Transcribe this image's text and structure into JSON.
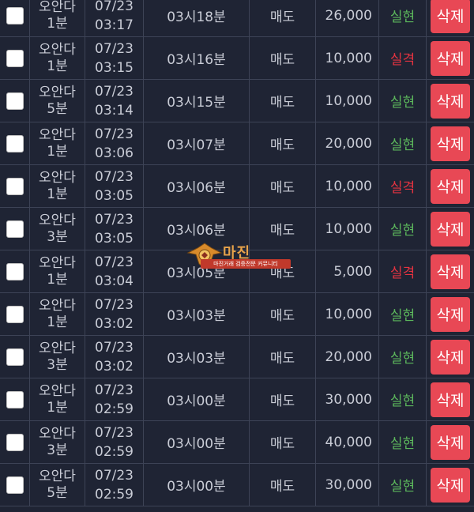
{
  "rows": [
    {
      "game": [
        "오안다",
        "1분"
      ],
      "date": "07/23",
      "time": "03:17",
      "round": "03시18분",
      "type": "매도",
      "amount": "26,000",
      "result": "실현",
      "status": "win",
      "action": "삭제"
    },
    {
      "game": [
        "오안다",
        "1분"
      ],
      "date": "07/23",
      "time": "03:15",
      "round": "03시16분",
      "type": "매도",
      "amount": "10,000",
      "result": "실격",
      "status": "lose",
      "action": "삭제"
    },
    {
      "game": [
        "오안다",
        "5분"
      ],
      "date": "07/23",
      "time": "03:14",
      "round": "03시15분",
      "type": "매도",
      "amount": "10,000",
      "result": "실현",
      "status": "win",
      "action": "삭제"
    },
    {
      "game": [
        "오안다",
        "1분"
      ],
      "date": "07/23",
      "time": "03:06",
      "round": "03시07분",
      "type": "매도",
      "amount": "20,000",
      "result": "실현",
      "status": "win",
      "action": "삭제"
    },
    {
      "game": [
        "오안다",
        "1분"
      ],
      "date": "07/23",
      "time": "03:05",
      "round": "03시06분",
      "type": "매도",
      "amount": "10,000",
      "result": "실격",
      "status": "lose",
      "action": "삭제"
    },
    {
      "game": [
        "오안다",
        "3분"
      ],
      "date": "07/23",
      "time": "03:05",
      "round": "03시06분",
      "type": "매도",
      "amount": "10,000",
      "result": "실현",
      "status": "win",
      "action": "삭제"
    },
    {
      "game": [
        "오안다",
        "1분"
      ],
      "date": "07/23",
      "time": "03:04",
      "round": "03시05분",
      "type": "매도",
      "amount": "5,000",
      "result": "실격",
      "status": "lose",
      "action": "삭제"
    },
    {
      "game": [
        "오안다",
        "1분"
      ],
      "date": "07/23",
      "time": "03:02",
      "round": "03시03분",
      "type": "매도",
      "amount": "10,000",
      "result": "실현",
      "status": "win",
      "action": "삭제"
    },
    {
      "game": [
        "오안다",
        "3분"
      ],
      "date": "07/23",
      "time": "03:02",
      "round": "03시03분",
      "type": "매도",
      "amount": "20,000",
      "result": "실현",
      "status": "win",
      "action": "삭제"
    },
    {
      "game": [
        "오안다",
        "1분"
      ],
      "date": "07/23",
      "time": "02:59",
      "round": "03시00분",
      "type": "매도",
      "amount": "30,000",
      "result": "실현",
      "status": "win",
      "action": "삭제"
    },
    {
      "game": [
        "오안다",
        "3분"
      ],
      "date": "07/23",
      "time": "02:59",
      "round": "03시00분",
      "type": "매도",
      "amount": "40,000",
      "result": "실현",
      "status": "win",
      "action": "삭제"
    },
    {
      "game": [
        "오안다",
        "5분"
      ],
      "date": "07/23",
      "time": "02:59",
      "round": "03시00분",
      "type": "매도",
      "amount": "30,000",
      "result": "실현",
      "status": "win",
      "action": "삭제"
    }
  ],
  "watermark": {
    "title": "마진",
    "subtitle": "마진거래 검증전문 커뮤니티"
  },
  "colors": {
    "background": "#1f2434",
    "win": "#5cb85c",
    "lose": "#e53340",
    "delete_button": "#e84855"
  }
}
